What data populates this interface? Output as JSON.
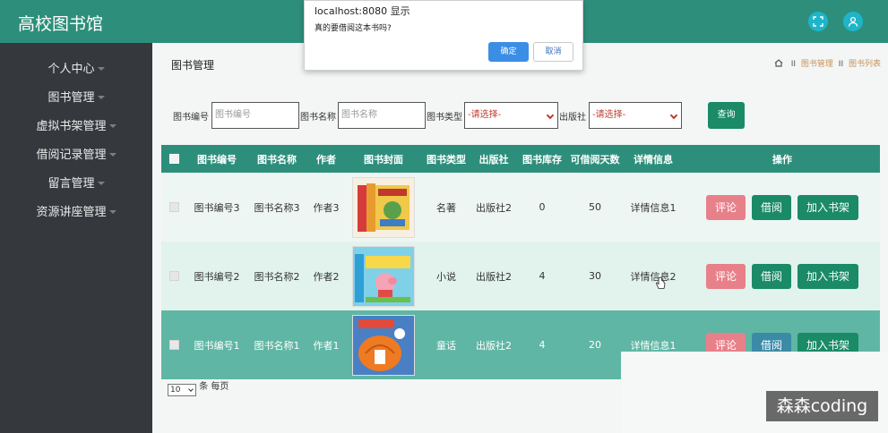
{
  "app": {
    "brand": "高校图书馆"
  },
  "header": {
    "buttons": [
      {
        "icon": "fullscreen-icon"
      },
      {
        "icon": "user-icon"
      }
    ]
  },
  "sidebar": {
    "items": [
      {
        "label": "个人中心"
      },
      {
        "label": "图书管理"
      },
      {
        "label": "虚拟书架管理"
      },
      {
        "label": "借阅记录管理"
      },
      {
        "label": "留言管理"
      },
      {
        "label": "资源讲座管理"
      }
    ]
  },
  "page": {
    "title": "图书管理",
    "breadcrumb": {
      "home_icon": "home-icon",
      "sep": "II",
      "level1": "图书管理",
      "level2": "图书列表"
    }
  },
  "filters": {
    "book_no": {
      "label": "图书编号",
      "placeholder": "图书编号"
    },
    "book_name": {
      "label": "图书名称",
      "placeholder": "图书名称"
    },
    "book_type": {
      "label": "图书类型",
      "value": "-请选择-"
    },
    "publisher": {
      "label": "出版社",
      "value": "-请选择-"
    },
    "query_label": "查询"
  },
  "table": {
    "headers": [
      "图书编号",
      "图书名称",
      "作者",
      "图书封面",
      "图书类型",
      "出版社",
      "图书库存",
      "可借阅天数",
      "详情信息",
      "操作"
    ],
    "rows": [
      {
        "book_no": "图书编号3",
        "name": "图书名称3",
        "author": "作者3",
        "type": "名著",
        "publisher": "出版社2",
        "stock": "0",
        "days": "50",
        "detail": "详情信息1",
        "cover": "cover-image-books-set"
      },
      {
        "book_no": "图书编号2",
        "name": "图书名称2",
        "author": "作者2",
        "type": "小说",
        "publisher": "出版社2",
        "stock": "4",
        "days": "30",
        "detail": "详情信息2",
        "cover": "cover-image-peppa-pig"
      },
      {
        "book_no": "图书编号1",
        "name": "图书名称1",
        "author": "作者1",
        "type": "童话",
        "publisher": "出版社2",
        "stock": "4",
        "days": "20",
        "detail": "详情信息1",
        "cover": "cover-image-pumpkin-house"
      }
    ],
    "actions": {
      "comment": "评论",
      "borrow": "借阅",
      "add_shelf": "加入书架"
    }
  },
  "pager": {
    "page_size": "10",
    "suffix": "条 每页"
  },
  "dialog": {
    "title": "localhost:8080 显示",
    "message": "真的要借阅这本书吗?",
    "ok": "确定",
    "cancel": "取消"
  },
  "watermark": "森森coding",
  "colors": {
    "primary": "#2d8f7b",
    "sidebar": "#35393e",
    "row_odd": "#eef6f3",
    "row_even": "#e1f3ec",
    "row_selected": "#5fb6a4",
    "comment_btn": "#e8808a",
    "borrow_btn": "#1a8a67",
    "dialog_ok": "#3b8ee6"
  }
}
